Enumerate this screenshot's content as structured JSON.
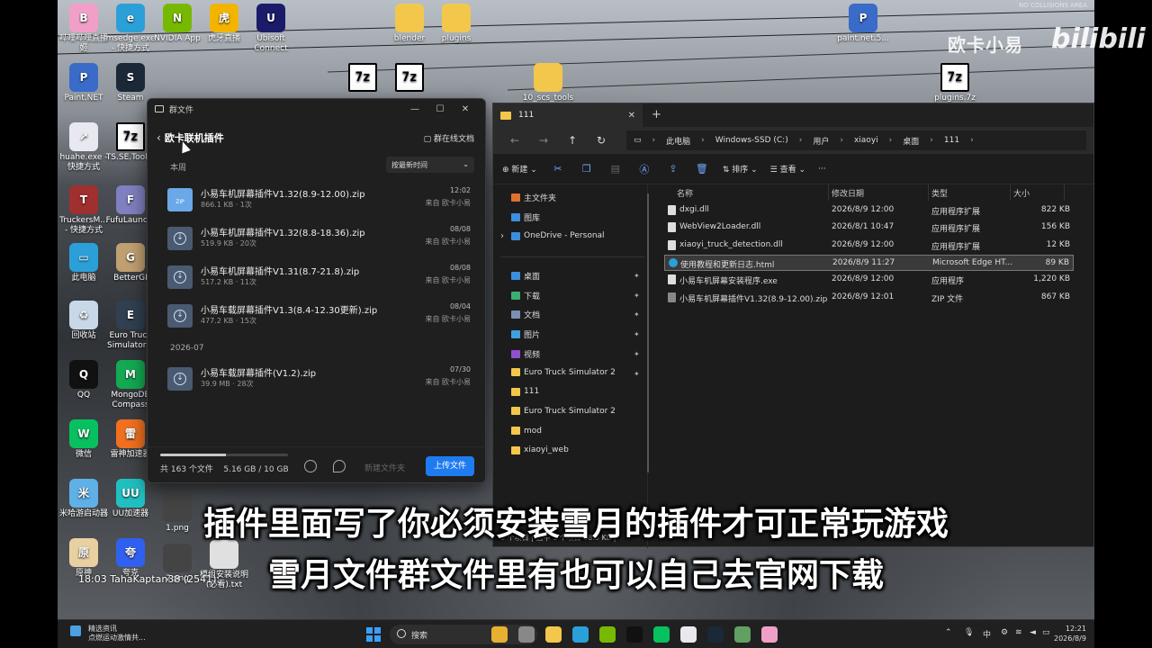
{
  "watermark": {
    "name": "欧卡小易",
    "brand": "bilibili",
    "corner_tag": "NO COLLISIONS AREA"
  },
  "desktop_icons": [
    {
      "label": "哔哩哔哩直播姬",
      "glyph": "B",
      "color": "#f0a0c8"
    },
    {
      "label": "msedge.exe - 快捷方式",
      "glyph": "e",
      "color": "#2ba0d8"
    },
    {
      "label": "NVIDIA App",
      "glyph": "N",
      "color": "#76b900"
    },
    {
      "label": "虎牙直播",
      "glyph": "虎",
      "color": "#f3b400"
    },
    {
      "label": "Ubisoft Connect",
      "glyph": "U",
      "color": "#1b1b6a"
    },
    {
      "label": "blender",
      "glyph": "",
      "color": "#f3c74b"
    },
    {
      "label": "plugins",
      "glyph": "",
      "color": "#f3c74b"
    },
    {
      "label": "paint.net.5...",
      "glyph": "P",
      "color": "#3a6bc8"
    },
    {
      "label": "Paint.NET",
      "glyph": "P",
      "color": "#3a6bc8"
    },
    {
      "label": "Steam",
      "glyph": "S",
      "color": "#1b2838"
    },
    {
      "label": "huahe.exe - 快捷方式",
      "glyph": "↗",
      "color": "#e8e8f0"
    },
    {
      "label": "TS.SE.Tool...",
      "glyph": "7z",
      "color": "#ffffff"
    },
    {
      "label": "TruckersM... - 快捷方式",
      "glyph": "T",
      "color": "#a03030"
    },
    {
      "label": "FufuLaunc...",
      "glyph": "F",
      "color": "#8080c0"
    },
    {
      "label": "此电脑",
      "glyph": "▭",
      "color": "#2ba0d8"
    },
    {
      "label": "BetterGI",
      "glyph": "G",
      "color": "#c0a070"
    },
    {
      "label": "回收站",
      "glyph": "♻",
      "color": "#c8d8e8"
    },
    {
      "label": "Euro Truck Simulator 2",
      "glyph": "E",
      "color": "#304050"
    },
    {
      "label": "QQ",
      "glyph": "Q",
      "color": "#111111"
    },
    {
      "label": "MongoDB Compass",
      "glyph": "M",
      "color": "#13aa52"
    },
    {
      "label": "微信",
      "glyph": "W",
      "color": "#07c160"
    },
    {
      "label": "雷神加速器",
      "glyph": "雷",
      "color": "#f07020"
    },
    {
      "label": "米哈游启动器",
      "glyph": "米",
      "color": "#60b0e8"
    },
    {
      "label": "UU加速器",
      "glyph": "UU",
      "color": "#20c0c0"
    },
    {
      "label": "1.png",
      "glyph": "",
      "color": "#444444"
    },
    {
      "label": "原神",
      "glyph": "原",
      "color": "#e8d0a0"
    },
    {
      "label": "夸克",
      "glyph": "夸",
      "color": "#3060f0"
    },
    {
      "label": "2.png",
      "glyph": "",
      "color": "#444444"
    },
    {
      "label": "模组安装说明(必看).txt",
      "glyph": "",
      "color": "#e0e0e0"
    },
    {
      "label": "10_scs_tools",
      "glyph": "",
      "color": "#f3c74b"
    },
    {
      "label": "",
      "glyph": "7z",
      "color": "#ffffff"
    },
    {
      "label": "",
      "glyph": "7z",
      "color": "#ffffff"
    },
    {
      "label": "plugins.7z",
      "glyph": "7z",
      "color": "#ffffff"
    }
  ],
  "qq_window": {
    "title": "群文件",
    "header": "欧卡联机插件",
    "online_docs": "群在线文档",
    "section_recent": "本周",
    "sort_label": "按最新时间",
    "section_month": "2026-07",
    "files": [
      {
        "name": "小易车机屏幕插件V1.32(8.9-12.00).zip",
        "meta": "866.1 KB · 1次",
        "date": "12:02",
        "from": "来自 欧卡小易",
        "icon": "zip"
      },
      {
        "name": "小易车机屏幕插件V1.32(8.8-18.36).zip",
        "meta": "519.9 KB · 20次",
        "date": "08/08",
        "from": "来自 欧卡小易",
        "icon": "dl"
      },
      {
        "name": "小易车机屏幕插件V1.31(8.7-21.8).zip",
        "meta": "517.2 KB · 11次",
        "date": "08/08",
        "from": "来自 欧卡小易",
        "icon": "dl"
      },
      {
        "name": "小易车载屏幕插件V1.3(8.4-12.30更新).zip",
        "meta": "477.2 KB · 15次",
        "date": "08/04",
        "from": "来自 欧卡小易",
        "icon": "dl"
      },
      {
        "name": "小易车载屏幕插件(V1.2).zip",
        "meta": "39.9 MB · 28次",
        "date": "07/30",
        "from": "来自 欧卡小易",
        "icon": "dl"
      }
    ],
    "storage_used_fraction": 0.516,
    "count_text": "共 163 个文件",
    "storage_text": "5.16 GB / 10 GB",
    "new_folder": "新建文件夹",
    "upload": "上传文件"
  },
  "explorer": {
    "tab_title": "111",
    "crumbs": [
      "此电脑",
      "Windows-SSD (C:)",
      "用户",
      "xiaoyi",
      "桌面",
      "111"
    ],
    "toolbar": {
      "new": "新建",
      "sort": "排序",
      "view": "查看"
    },
    "nav_top": [
      {
        "label": "主文件夹",
        "color": "#e07030"
      },
      {
        "label": "图库",
        "color": "#3a90e0"
      },
      {
        "label": "OneDrive - Personal",
        "color": "#3a90e0"
      }
    ],
    "nav_pinned": [
      {
        "label": "桌面",
        "color": "#3a90e0"
      },
      {
        "label": "下载",
        "color": "#3ab070"
      },
      {
        "label": "文档",
        "color": "#7a90b0"
      },
      {
        "label": "图片",
        "color": "#40a0e0"
      },
      {
        "label": "视频",
        "color": "#9050d0"
      },
      {
        "label": "Euro Truck Simulator 2",
        "color": "#f3c74b"
      }
    ],
    "nav_folders": [
      {
        "label": "111",
        "color": "#f3c74b"
      },
      {
        "label": "Euro Truck Simulator 2",
        "color": "#f3c74b"
      },
      {
        "label": "mod",
        "color": "#f3c74b"
      },
      {
        "label": "xiaoyi_web",
        "color": "#f3c74b"
      }
    ],
    "nav_pc": "此电脑",
    "columns": {
      "name": "名称",
      "date": "修改日期",
      "type": "类型",
      "size": "大小"
    },
    "files": [
      {
        "name": "dxgi.dll",
        "date": "2026/8/9 12:00",
        "type": "应用程序扩展",
        "size": "822 KB",
        "icon": "file",
        "selected": false
      },
      {
        "name": "WebView2Loader.dll",
        "date": "2026/8/1 10:47",
        "type": "应用程序扩展",
        "size": "156 KB",
        "icon": "file",
        "selected": false
      },
      {
        "name": "xiaoyi_truck_detection.dll",
        "date": "2026/8/9 12:00",
        "type": "应用程序扩展",
        "size": "12 KB",
        "icon": "file",
        "selected": false
      },
      {
        "name": "使用教程和更新日志.html",
        "date": "2026/8/9 11:27",
        "type": "Microsoft Edge HT...",
        "size": "89 KB",
        "icon": "edge",
        "selected": true
      },
      {
        "name": "小易车机屏幕安装程序.exe",
        "date": "2026/8/9 12:00",
        "type": "应用程序",
        "size": "1,220 KB",
        "icon": "file",
        "selected": false
      },
      {
        "name": "小易车机屏幕插件V1.32(8.9-12.00).zip",
        "date": "2026/8/9 12:01",
        "type": "ZIP 文件",
        "size": "867 KB",
        "icon": "zip",
        "selected": false
      }
    ],
    "status": "6 个项目  |  选中 1 个项目 88.5 KB  |"
  },
  "subtitles": [
    "插件里面写了你必须安装雪月的插件才可正常玩游戏",
    "雪月文件群文件里有也可以自己去官网下载"
  ],
  "chat_line": "18:03 TahaKaptan38 (2541):",
  "taskbar": {
    "news_title": "精选资讯",
    "news_sub": "点燃运动激情共...",
    "search": "搜索",
    "ime": "中",
    "time": "12:21",
    "date": "2026/8/9",
    "apps": [
      {
        "name": "chrome",
        "color": "#e8b030"
      },
      {
        "name": "taskview",
        "color": "#888888"
      },
      {
        "name": "explorer",
        "color": "#f3c74b"
      },
      {
        "name": "edge",
        "color": "#2ba0d8"
      },
      {
        "name": "nvidia",
        "color": "#76b900"
      },
      {
        "name": "qq",
        "color": "#111111"
      },
      {
        "name": "wechat",
        "color": "#07c160"
      },
      {
        "name": "huahe",
        "color": "#e8e8f0"
      },
      {
        "name": "steam",
        "color": "#1b2838"
      },
      {
        "name": "notepad",
        "color": "#60a060"
      },
      {
        "name": "bilibili",
        "color": "#f0a0c8"
      }
    ]
  }
}
